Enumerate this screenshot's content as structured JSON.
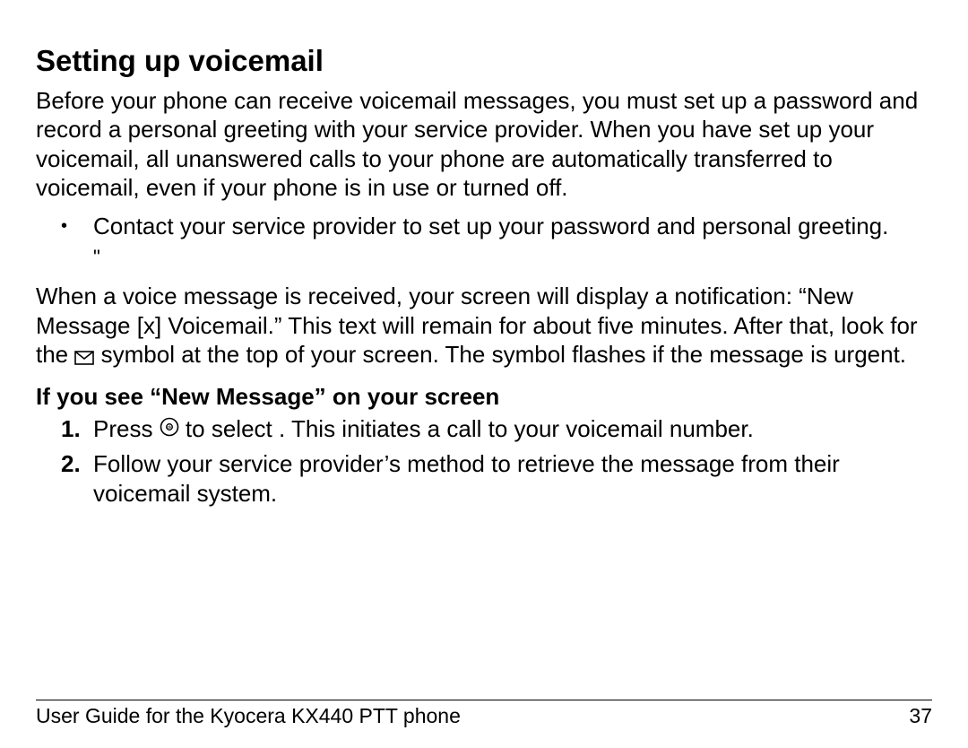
{
  "title": "Setting up voicemail",
  "intro": "Before your phone can receive voicemail messages, you must set up a password and record a personal greeting with your service provider. When you have set up your voicemail, all unanswered calls to your phone are automatically transferred to voicemail, even if your phone is in use or turned off.",
  "bullet1": "Contact your service provider to set up your password and personal greeting.",
  "ditto": "\"",
  "notify_a": "When a voice message is received, your screen will display a notification: “New Message [x] Voicemail.” This text will remain for about five minutes. After that, look for the ",
  "notify_b": " symbol at the top of your screen. The symbol flashes if the message is urgent.",
  "sub_heading": "If you see “New Message” on your screen",
  "step1_a": "Press ",
  "step1_b": " to select      . This initiates a call to your voicemail number.",
  "step2": "Follow your service provider’s method to retrieve the message from their voicemail system.",
  "footer_left": "User Guide for the Kyocera KX440 PTT phone",
  "footer_right": "37",
  "icons": {
    "mail": "mail-icon",
    "ok": "ok-icon"
  }
}
